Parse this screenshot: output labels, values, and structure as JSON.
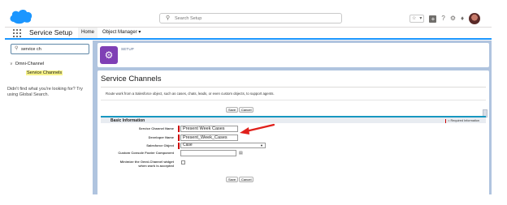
{
  "header": {
    "search_placeholder": "Search Setup",
    "icons": [
      "star-icon",
      "chevron-down-icon",
      "add-icon",
      "help-icon",
      "gear-icon",
      "bell-icon"
    ]
  },
  "nav": {
    "app_name": "Service Setup",
    "tabs": [
      {
        "label": "Home",
        "selected": true
      },
      {
        "label": "Object Manager",
        "selected": false
      }
    ],
    "obj_chevron": "⌄"
  },
  "sidebar": {
    "quick_find_value": "service ch",
    "tree_parent": "Omni-Channel",
    "tree_child": "Service Channels",
    "not_found": "Didn't find what you're looking for? Try using Global Search."
  },
  "banner": {
    "label": "SETUP"
  },
  "page": {
    "title": "Service Channels",
    "description": "Route work from a Salesforce object, such as cases, chats, leads, or even custom objects, to support agents.",
    "save_label": "Save",
    "cancel_label": "Cancel",
    "section_title": "Basic Information",
    "required_legend": "= Required Information"
  },
  "form": {
    "service_channel_name_label": "Service Channel Name",
    "service_channel_name_value": "Present Week Cases",
    "developer_name_label": "Developer Name",
    "developer_name_value": "Present_Week_Cases",
    "salesforce_object_label": "Salesforce Object",
    "salesforce_object_value": "Case",
    "custom_console_label": "Custom Console Footer Component",
    "custom_console_value": "",
    "minimize_label_1": "Minimize the Omni-Channel widget",
    "minimize_label_2": "when work is accepted"
  },
  "colors": {
    "accent": "#1b96ff",
    "setup_badge": "#7f3fb5",
    "annotation_arrow": "#e0201b"
  }
}
